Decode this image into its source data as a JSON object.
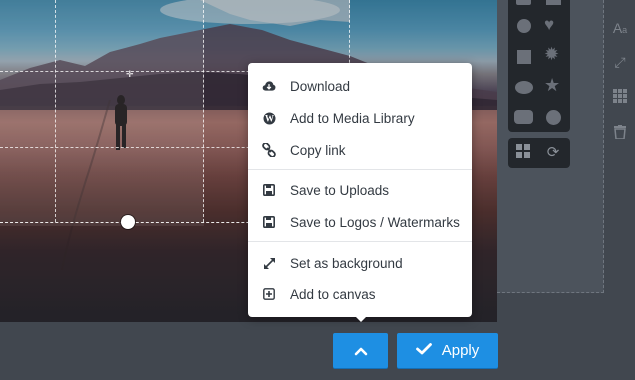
{
  "menu": {
    "items": [
      {
        "label": "Download",
        "icon": "cloud-download-icon"
      },
      {
        "label": "Add to Media Library",
        "icon": "wordpress-icon"
      },
      {
        "label": "Copy link",
        "icon": "link-icon"
      },
      {
        "label": "Save to Uploads",
        "icon": "floppy-disk-icon"
      },
      {
        "label": "Save to Logos / Watermarks",
        "icon": "floppy-disk-icon"
      },
      {
        "label": "Set as background",
        "icon": "expand-arrows-icon"
      },
      {
        "label": "Add to canvas",
        "icon": "plus-square-icon"
      }
    ]
  },
  "actions": {
    "apply_label": "Apply",
    "toggle_icon": "chevron-up-icon"
  },
  "colors": {
    "accent": "#1e8fe3",
    "menu_bg": "#ffffff",
    "panel_bg": "#23272c",
    "workspace_bg": "#41474f"
  }
}
